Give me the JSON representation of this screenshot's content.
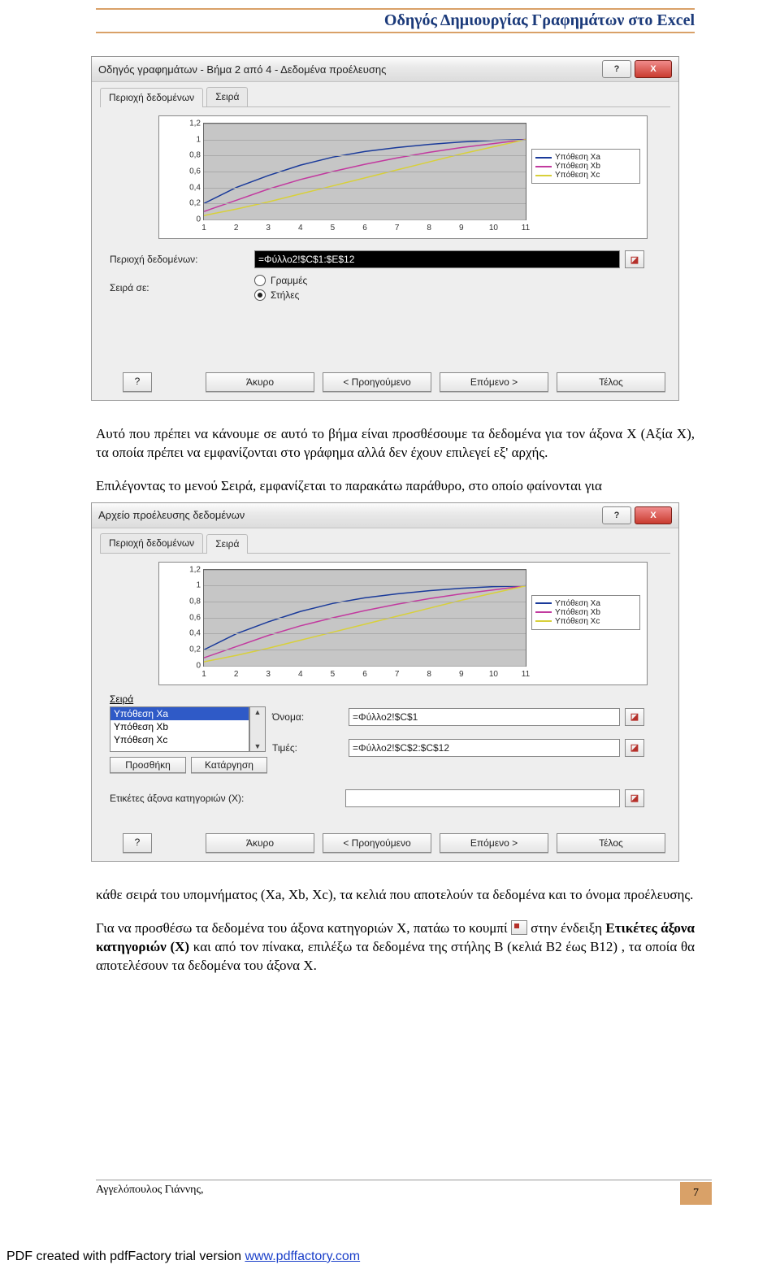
{
  "header": {
    "title": "Οδηγός Δημιουργίας Γραφημάτων στο Excel"
  },
  "dialog1": {
    "title": "Οδηγός γραφημάτων - Βήμα 2 από 4 - Δεδομένα προέλευσης",
    "tabs": [
      "Περιοχή δεδομένων",
      "Σειρά"
    ],
    "active_tab": 0,
    "range_label": "Περιοχή δεδομένων:",
    "range_value": "=Φύλλο2!$C$1:$E$12",
    "series_in_label": "Σειρά σε:",
    "radio_rows": "Γραμμές",
    "radio_cols": "Στήλες",
    "buttons": {
      "help": "?",
      "cancel": "Άκυρο",
      "prev": "< Προηγούμενο",
      "next": "Επόμενο >",
      "finish": "Τέλος"
    }
  },
  "dialog2": {
    "title": "Αρχείο προέλευσης δεδομένων",
    "tabs": [
      "Περιοχή δεδομένων",
      "Σειρά"
    ],
    "active_tab": 1,
    "series_label": "Σειρά",
    "series_items": [
      "Υπόθεση Χa",
      "Υπόθεση Xb",
      "Υπόθεση Xc"
    ],
    "selected_series_index": 0,
    "name_label": "Όνομα:",
    "name_value": "=Φύλλο2!$C$1",
    "values_label": "Τιμές:",
    "values_value": "=Φύλλο2!$C$2:$C$12",
    "add_btn": "Προσθήκη",
    "remove_btn": "Κατάργηση",
    "cat_label": "Ετικέτες άξονα κατηγοριών (X):",
    "cat_value": "",
    "buttons": {
      "help": "?",
      "cancel": "Άκυρο",
      "prev": "< Προηγούμενο",
      "next": "Επόμενο >",
      "finish": "Τέλος"
    }
  },
  "chart_data": {
    "type": "line",
    "x": [
      1,
      2,
      3,
      4,
      5,
      6,
      7,
      8,
      9,
      10,
      11
    ],
    "series": [
      {
        "name": "Υπόθεση Χa",
        "color": "#1a3a9a",
        "values": [
          0.2,
          0.4,
          0.55,
          0.68,
          0.78,
          0.85,
          0.9,
          0.94,
          0.97,
          0.99,
          1.0
        ]
      },
      {
        "name": "Υπόθεση Χb",
        "color": "#c23a9f",
        "values": [
          0.1,
          0.24,
          0.38,
          0.5,
          0.6,
          0.69,
          0.77,
          0.84,
          0.9,
          0.95,
          1.0
        ]
      },
      {
        "name": "Υπόθεση Χc",
        "color": "#d8d03a",
        "values": [
          0.05,
          0.13,
          0.22,
          0.32,
          0.42,
          0.52,
          0.62,
          0.72,
          0.82,
          0.91,
          1.0
        ]
      }
    ],
    "xlabel": "",
    "ylabel": "",
    "yticks": [
      0,
      0.2,
      0.4,
      0.6,
      0.8,
      1,
      1.2
    ],
    "ylim": [
      0,
      1.2
    ]
  },
  "paragraphs": {
    "p1": "Αυτό που πρέπει να κάνουμε σε αυτό το βήμα είναι προσθέσουμε τα δεδομένα για τον άξονα Χ (Αξία Χ), τα οποία πρέπει να εμφανίζονται στο γράφημα αλλά δεν έχουν επιλεγεί εξ' αρχής.",
    "p2": "Επιλέγοντας το μενού Σειρά, εμφανίζεται το παρακάτω παράθυρο, στο οποίο φαίνονται για",
    "p3": "κάθε σειρά του υπομνήματος (Xa, Xb, Xc), τα κελιά που αποτελούν τα δεδομένα και το όνομα προέλευσης.",
    "p4a": "Για να προσθέσω τα δεδομένα του άξονα κατηγοριών Χ, πατάω το κουμπί ",
    "p4b": " στην ένδειξη ",
    "p4c": "Ετικέτες άξονα κατηγοριών (Χ)",
    "p4d": "  και από τον πίνακα, επιλέξω τα δεδομένα  της στήλης B (κελιά B2 έως B12) , τα οποία θα αποτελέσουν τα δεδομένα  του άξονα Χ."
  },
  "footer": {
    "author": "Αγγελόπουλος Γιάννης,",
    "page_number": "7"
  },
  "pdf_footer": {
    "text_prefix": "PDF created with pdfFactory trial version ",
    "link_text": "www.pdffactory.com"
  }
}
